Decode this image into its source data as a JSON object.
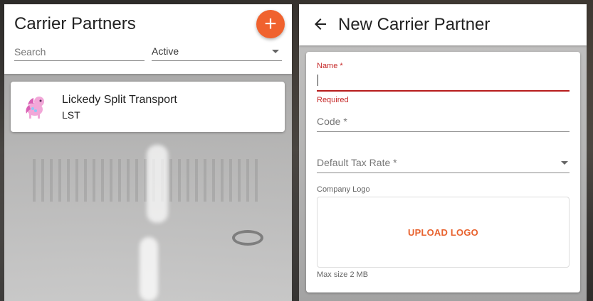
{
  "left_panel": {
    "title": "Carrier Partners",
    "add_button_glyph": "+",
    "search": {
      "placeholder": "Search",
      "value": ""
    },
    "status_filter": {
      "selected": "Active"
    },
    "items": [
      {
        "name": "Lickedy Split Transport",
        "code": "LST",
        "avatar_icon": "pink-pony-icon"
      }
    ]
  },
  "right_panel": {
    "title": "New Carrier Partner",
    "back_icon": "arrow-left-icon",
    "form": {
      "name_label": "Name *",
      "name_value": "",
      "name_error": "Required",
      "code_placeholder": "Code *",
      "tax_rate_placeholder": "Default Tax Rate *",
      "logo_label": "Company Logo",
      "upload_label": "UPLOAD LOGO",
      "max_size": "Max size 2 MB"
    }
  },
  "colors": {
    "accent": "#f0622e",
    "error": "#c62828",
    "text": "#212121"
  }
}
